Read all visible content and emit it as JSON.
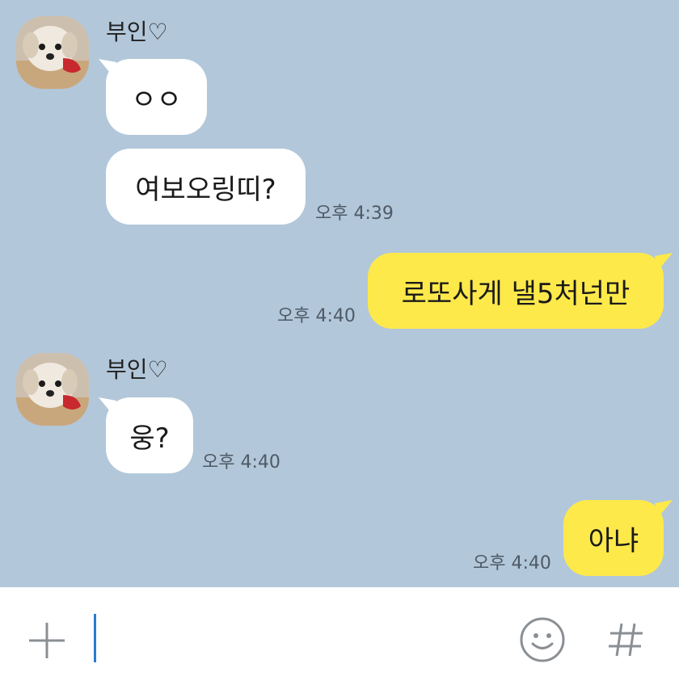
{
  "chat": {
    "messages": [
      {
        "type": "received",
        "sender": "부인♡",
        "text": "ㅇㅇ"
      },
      {
        "type": "received",
        "text": "여보오링띠?",
        "time": "오후 4:39"
      },
      {
        "type": "sent",
        "text": "로또사게 낼5처넌만",
        "time": "오후 4:40"
      },
      {
        "type": "received",
        "sender": "부인♡",
        "text": "웅?",
        "time": "오후 4:40"
      },
      {
        "type": "sent",
        "text": "아냐",
        "time": "오후 4:40"
      }
    ]
  },
  "input_bar": {
    "icons": [
      "plus-icon",
      "emoji-icon",
      "hashtag-icon"
    ],
    "text_value": ""
  },
  "colors": {
    "chat_background": "#b2c7da",
    "sent_bubble": "#fde94a",
    "received_bubble": "#ffffff",
    "caret": "#2b7cd3"
  }
}
